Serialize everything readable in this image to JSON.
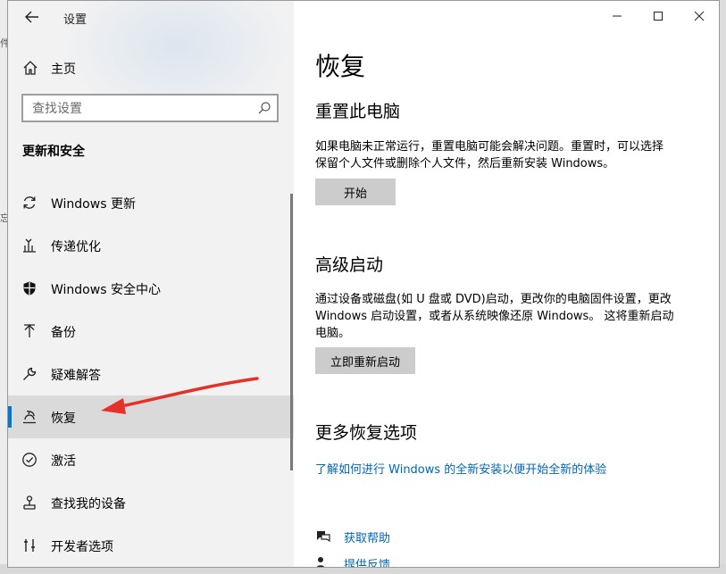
{
  "window": {
    "title": "设置"
  },
  "background": {
    "edge_text": [
      "件",
      "忘"
    ]
  },
  "sidebar": {
    "home_label": "主页",
    "search_placeholder": "查找设置",
    "section_title": "更新和安全",
    "items": [
      {
        "label": "Windows 更新",
        "icon": "refresh-icon",
        "selected": false
      },
      {
        "label": "传递优化",
        "icon": "delivery-optimization-icon",
        "selected": false
      },
      {
        "label": "Windows 安全中心",
        "icon": "shield-icon",
        "selected": false
      },
      {
        "label": "备份",
        "icon": "backup-arrow-icon",
        "selected": false
      },
      {
        "label": "疑难解答",
        "icon": "wrench-icon",
        "selected": false
      },
      {
        "label": "恢复",
        "icon": "recovery-icon",
        "selected": true
      },
      {
        "label": "激活",
        "icon": "check-circle-icon",
        "selected": false
      },
      {
        "label": "查找我的设备",
        "icon": "find-device-icon",
        "selected": false
      },
      {
        "label": "开发者选项",
        "icon": "developer-icon",
        "selected": false
      }
    ]
  },
  "content": {
    "page_title": "恢复",
    "reset": {
      "heading": "重置此电脑",
      "description_line1": "如果电脑未正常运行，重置电脑可能会解决问题。重置时，可以选择",
      "description_line2": "保留个人文件或删除个人文件，然后重新安装 Windows。",
      "button": "开始"
    },
    "advanced": {
      "heading": "高级启动",
      "description_line1": "通过设备或磁盘(如 U 盘或 DVD)启动，更改你的电脑固件设置，更改",
      "description_line2": "Windows 启动设置，或者从系统映像还原 Windows。 这将重新启动",
      "description_line3": "电脑。",
      "button": "立即重新启动"
    },
    "more": {
      "heading": "更多恢复选项",
      "link": "了解如何进行 Windows 的全新安装以便开始全新的体验"
    },
    "help": {
      "get_help": "获取帮助",
      "feedback": "提供反馈"
    }
  },
  "colors": {
    "accent": "#0078d7",
    "link": "#0066b4",
    "annotation_arrow": "#e8302a"
  }
}
